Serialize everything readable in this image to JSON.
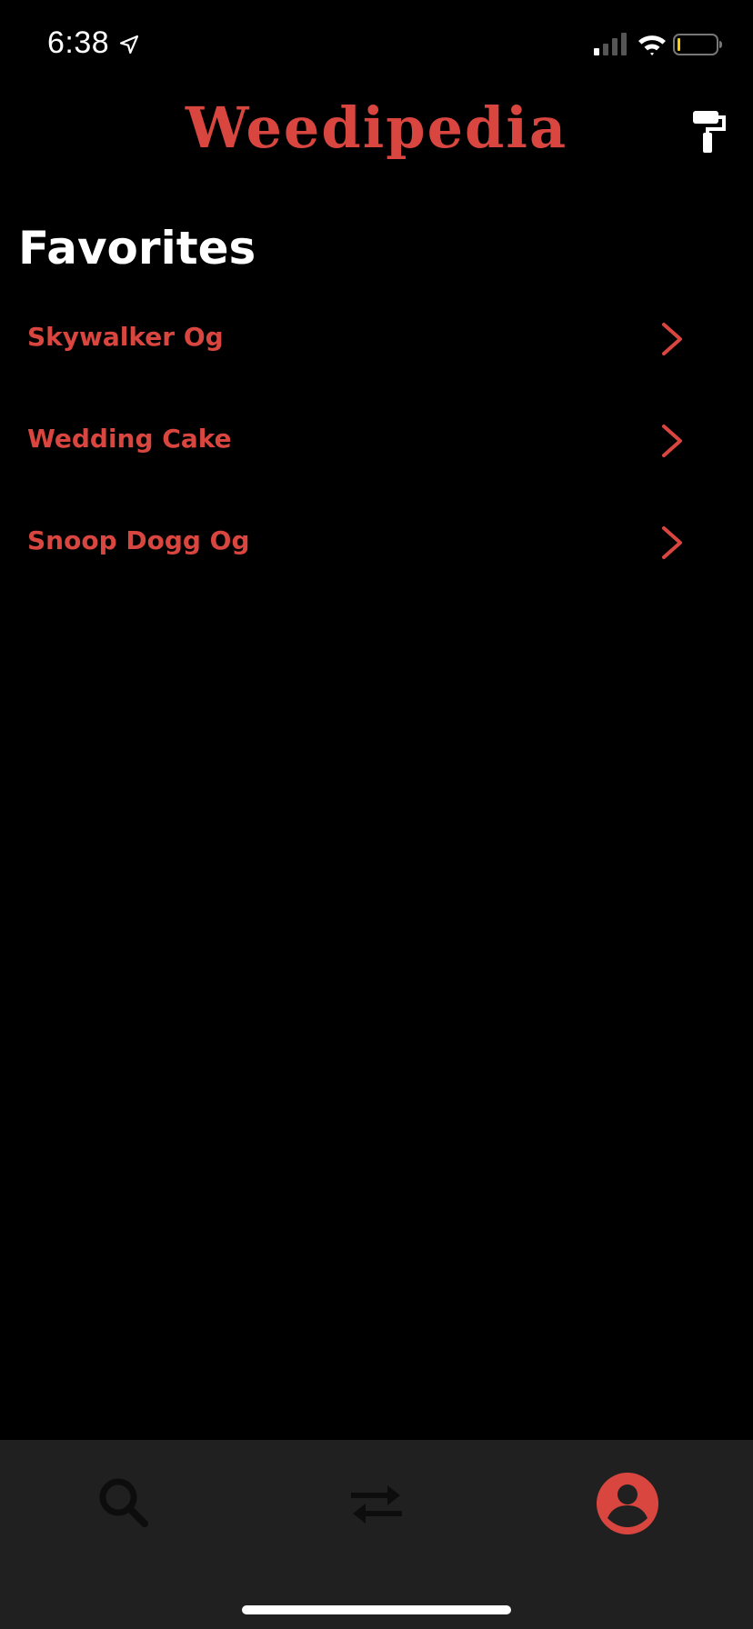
{
  "status_bar": {
    "time": "6:38",
    "location_icon": "location-arrow-icon",
    "signal_icon": "cellular-signal-icon",
    "wifi_icon": "wifi-icon",
    "battery_icon": "battery-icon",
    "battery_level_color": "#ffcc00"
  },
  "header": {
    "title": "Weedipedia",
    "title_color": "#d9463f",
    "action_icon": "paint-roller-icon"
  },
  "favorites": {
    "title": "Favorites",
    "items": [
      {
        "label": "Skywalker Og"
      },
      {
        "label": "Wedding Cake"
      },
      {
        "label": "Snoop Dogg Og"
      }
    ],
    "item_color": "#d9463f",
    "chevron_icon": "chevron-right-icon"
  },
  "tab_bar": {
    "tabs": [
      {
        "name": "search",
        "icon": "search-icon",
        "active": false
      },
      {
        "name": "swap",
        "icon": "swap-arrows-icon",
        "active": false
      },
      {
        "name": "profile",
        "icon": "profile-icon",
        "active": true
      }
    ],
    "active_color": "#d9463f",
    "inactive_color": "#0d0d0d",
    "background": "#202020"
  }
}
